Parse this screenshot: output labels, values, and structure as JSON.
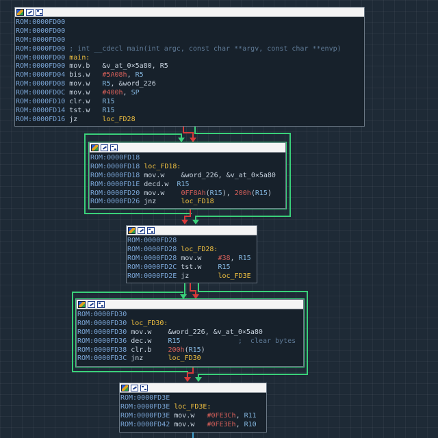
{
  "colors": {
    "background": "#1e2a36",
    "node_bg": "#17212b",
    "address": "#7aa5d6",
    "label": "#f0c040",
    "immediate": "#d8605a",
    "register": "#86b9e2",
    "comment": "#5f7a96",
    "edge_true": "#3ad07a",
    "edge_false": "#d83a3a",
    "edge_normal": "#3ea0d0"
  },
  "header_icons": [
    "color-palette-icon",
    "edit-pencil-icon",
    "graph-overview-icon"
  ],
  "nodes": [
    {
      "id": "n0",
      "lines": [
        [
          {
            "t": "ROM:0000FD00",
            "c": "addr"
          }
        ],
        [
          {
            "t": "ROM:0000FD00",
            "c": "addr"
          }
        ],
        [
          {
            "t": "ROM:0000FD00",
            "c": "addr"
          }
        ],
        [
          {
            "t": "ROM:0000FD00",
            "c": "addr"
          },
          {
            "t": " ; int __cdecl main(int argc, const char **argv, const char **envp)",
            "c": "cmt"
          }
        ],
        [
          {
            "t": "ROM:0000FD00",
            "c": "addr"
          },
          {
            "t": " main:",
            "c": "lbl"
          }
        ],
        [
          {
            "t": "ROM:0000FD00",
            "c": "addr"
          },
          {
            "t": " mov.b   ",
            "c": "mnem"
          },
          {
            "t": "&v_at_0×5a80, R5",
            "c": "mnem"
          }
        ],
        [
          {
            "t": "ROM:0000FD04",
            "c": "addr"
          },
          {
            "t": " bis.w   ",
            "c": "mnem"
          },
          {
            "t": "#5A08h",
            "c": "imm"
          },
          {
            "t": ", ",
            "c": "mnem"
          },
          {
            "t": "R5",
            "c": "reg"
          }
        ],
        [
          {
            "t": "ROM:0000FD08",
            "c": "addr"
          },
          {
            "t": " mov.w   ",
            "c": "mnem"
          },
          {
            "t": "R5",
            "c": "reg"
          },
          {
            "t": ", &word_226",
            "c": "mnem"
          }
        ],
        [
          {
            "t": "ROM:0000FD0C",
            "c": "addr"
          },
          {
            "t": " mov.w   ",
            "c": "mnem"
          },
          {
            "t": "#400h",
            "c": "imm"
          },
          {
            "t": ", ",
            "c": "mnem"
          },
          {
            "t": "SP",
            "c": "reg"
          }
        ],
        [
          {
            "t": "ROM:0000FD10",
            "c": "addr"
          },
          {
            "t": " clr.w   ",
            "c": "mnem"
          },
          {
            "t": "R15",
            "c": "reg"
          }
        ],
        [
          {
            "t": "ROM:0000FD14",
            "c": "addr"
          },
          {
            "t": " tst.w   ",
            "c": "mnem"
          },
          {
            "t": "R15",
            "c": "reg"
          }
        ],
        [
          {
            "t": "ROM:0000FD16",
            "c": "addr"
          },
          {
            "t": " jz      ",
            "c": "mnem"
          },
          {
            "t": "loc_FD28",
            "c": "lbl"
          }
        ]
      ]
    },
    {
      "id": "n1",
      "lines": [
        [
          {
            "t": "ROM:0000FD18",
            "c": "addr"
          }
        ],
        [
          {
            "t": "ROM:0000FD18",
            "c": "addr"
          },
          {
            "t": " loc_FD18:",
            "c": "lbl"
          }
        ],
        [
          {
            "t": "ROM:0000FD18",
            "c": "addr"
          },
          {
            "t": " mov.w    ",
            "c": "mnem"
          },
          {
            "t": "&word_226, &v_at_0×5a80",
            "c": "mnem"
          }
        ],
        [
          {
            "t": "ROM:0000FD1E",
            "c": "addr"
          },
          {
            "t": " decd.w  ",
            "c": "mnem"
          },
          {
            "t": "R15",
            "c": "reg"
          }
        ],
        [
          {
            "t": "ROM:0000FD20",
            "c": "addr"
          },
          {
            "t": " mov.w    ",
            "c": "mnem"
          },
          {
            "t": "0FF8Ah",
            "c": "imm"
          },
          {
            "t": "(",
            "c": "mnem"
          },
          {
            "t": "R15",
            "c": "reg"
          },
          {
            "t": "), ",
            "c": "mnem"
          },
          {
            "t": "200h",
            "c": "imm"
          },
          {
            "t": "(",
            "c": "mnem"
          },
          {
            "t": "R15",
            "c": "reg"
          },
          {
            "t": ")",
            "c": "mnem"
          }
        ],
        [
          {
            "t": "ROM:0000FD26",
            "c": "addr"
          },
          {
            "t": " jnz      ",
            "c": "mnem"
          },
          {
            "t": "loc_FD18",
            "c": "lbl"
          }
        ]
      ]
    },
    {
      "id": "n2",
      "lines": [
        [
          {
            "t": "ROM:0000FD28",
            "c": "addr"
          }
        ],
        [
          {
            "t": "ROM:0000FD28",
            "c": "addr"
          },
          {
            "t": " loc_FD28:",
            "c": "lbl"
          }
        ],
        [
          {
            "t": "ROM:0000FD28",
            "c": "addr"
          },
          {
            "t": " mov.w    ",
            "c": "mnem"
          },
          {
            "t": "#38",
            "c": "imm"
          },
          {
            "t": ", ",
            "c": "mnem"
          },
          {
            "t": "R15",
            "c": "reg"
          }
        ],
        [
          {
            "t": "ROM:0000FD2C",
            "c": "addr"
          },
          {
            "t": " tst.w    ",
            "c": "mnem"
          },
          {
            "t": "R15",
            "c": "reg"
          }
        ],
        [
          {
            "t": "ROM:0000FD2E",
            "c": "addr"
          },
          {
            "t": " jz       ",
            "c": "mnem"
          },
          {
            "t": "loc_FD3E",
            "c": "lbl"
          }
        ]
      ]
    },
    {
      "id": "n3",
      "lines": [
        [
          {
            "t": "ROM:0000FD30",
            "c": "addr"
          }
        ],
        [
          {
            "t": "ROM:0000FD30",
            "c": "addr"
          },
          {
            "t": " loc_FD30:",
            "c": "lbl"
          }
        ],
        [
          {
            "t": "ROM:0000FD30",
            "c": "addr"
          },
          {
            "t": " mov.w    ",
            "c": "mnem"
          },
          {
            "t": "&word_226, &v_at_0×5a80",
            "c": "mnem"
          }
        ],
        [
          {
            "t": "ROM:0000FD36",
            "c": "addr"
          },
          {
            "t": " dec.w    ",
            "c": "mnem"
          },
          {
            "t": "R15",
            "c": "reg"
          },
          {
            "t": "              ;  clear bytes",
            "c": "cmt"
          }
        ],
        [
          {
            "t": "ROM:0000FD38",
            "c": "addr"
          },
          {
            "t": " clr.b    ",
            "c": "mnem"
          },
          {
            "t": "200h",
            "c": "imm"
          },
          {
            "t": "(",
            "c": "mnem"
          },
          {
            "t": "R15",
            "c": "reg"
          },
          {
            "t": ")",
            "c": "mnem"
          }
        ],
        [
          {
            "t": "ROM:0000FD3C",
            "c": "addr"
          },
          {
            "t": " jnz      ",
            "c": "mnem"
          },
          {
            "t": "loc_FD30",
            "c": "lbl"
          }
        ]
      ]
    },
    {
      "id": "n4",
      "lines": [
        [
          {
            "t": "ROM:0000FD3E",
            "c": "addr"
          }
        ],
        [
          {
            "t": "ROM:0000FD3E",
            "c": "addr"
          },
          {
            "t": " loc_FD3E:",
            "c": "lbl"
          }
        ],
        [
          {
            "t": "ROM:0000FD3E",
            "c": "addr"
          },
          {
            "t": " mov.w   ",
            "c": "mnem"
          },
          {
            "t": "#0FE3Ch",
            "c": "imm"
          },
          {
            "t": ", ",
            "c": "mnem"
          },
          {
            "t": "R11",
            "c": "reg"
          }
        ],
        [
          {
            "t": "ROM:0000FD42",
            "c": "addr"
          },
          {
            "t": " mov.w   ",
            "c": "mnem"
          },
          {
            "t": "#0FE3Eh",
            "c": "imm"
          },
          {
            "t": ", ",
            "c": "mnem"
          },
          {
            "t": "R10",
            "c": "reg"
          }
        ]
      ]
    }
  ]
}
